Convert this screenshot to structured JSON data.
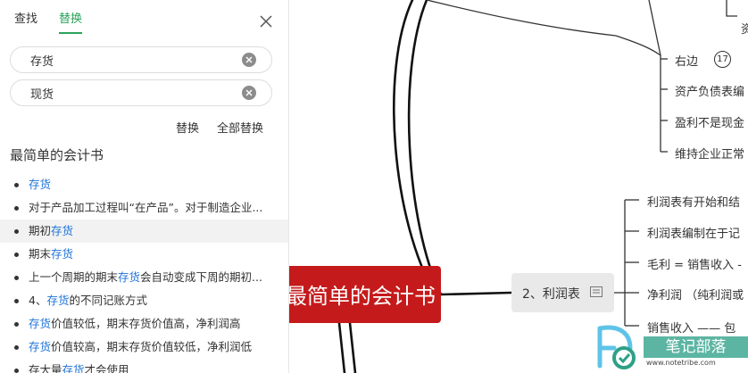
{
  "panel": {
    "tabs": [
      {
        "label": "查找",
        "active": false
      },
      {
        "label": "替换",
        "active": true
      }
    ],
    "find_value": "存货",
    "replace_value": "现货",
    "replace_label": "替换",
    "replace_all_label": "全部替换",
    "doc_title": "最简单的会计书",
    "results": [
      {
        "pre": "",
        "kw": "存货",
        "post": ""
      },
      {
        "pre": "对于产品加工过程叫“在产品”。对于制造企业...",
        "kw": "",
        "post": ""
      },
      {
        "pre": "期初",
        "kw": "存货",
        "post": ""
      },
      {
        "pre": "期末",
        "kw": "存货",
        "post": ""
      },
      {
        "pre": "上一个周期的期末",
        "kw": "存货",
        "post": "会自动变成下周的期初..."
      },
      {
        "pre": "4、",
        "kw": "存货",
        "post": "的不同记账方式"
      },
      {
        "pre": "",
        "kw": "存货",
        "post": "价值较低，期末存货价值高，净利润高"
      },
      {
        "pre": "",
        "kw": "存货",
        "post": "价值较高，期末存货价值较低，净利润低"
      },
      {
        "pre": "存大量",
        "kw": "存货",
        "post": "才会使用"
      }
    ]
  },
  "mindmap": {
    "root": "最简单的会计书",
    "node2": "2、利润表",
    "upper_items": [
      {
        "text": "资"
      },
      {
        "text": "右边"
      },
      {
        "text": "资产负债表编"
      },
      {
        "text": "盈利不是现金"
      },
      {
        "text": "维持企业正常"
      }
    ],
    "badge": "17",
    "lower_items": [
      {
        "text": "利润表有开始和结"
      },
      {
        "text": "利润表编制在于记"
      },
      {
        "text": "毛利 = 销售收入 -"
      },
      {
        "text": "净利润 （纯利润或"
      },
      {
        "text": "销售收入 —— 包"
      }
    ]
  },
  "watermark": {
    "title": "笔记部落",
    "url": "www.notetribe.com"
  },
  "colors": {
    "accent": "#2aa35a",
    "root": "#c51a1b",
    "keyword": "#1e72d8",
    "watermark": "#2ea088"
  }
}
